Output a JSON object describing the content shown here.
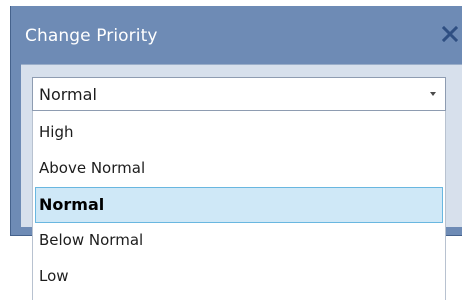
{
  "dialog": {
    "title": "Change Priority",
    "close_icon": "close-x-icon"
  },
  "priority_select": {
    "current_value": "Normal",
    "arrow_icon": "chevron-down-icon",
    "options": [
      {
        "label": "High",
        "selected": false
      },
      {
        "label": "Above Normal",
        "selected": false
      },
      {
        "label": "Normal",
        "selected": true
      },
      {
        "label": "Below Normal",
        "selected": false
      },
      {
        "label": "Low",
        "selected": false
      }
    ]
  },
  "colors": {
    "titlebar": "#6e8bb5",
    "body": "#d7e0ec",
    "selection_fill": "#cfe8f7",
    "selection_border": "#69b7e0"
  }
}
